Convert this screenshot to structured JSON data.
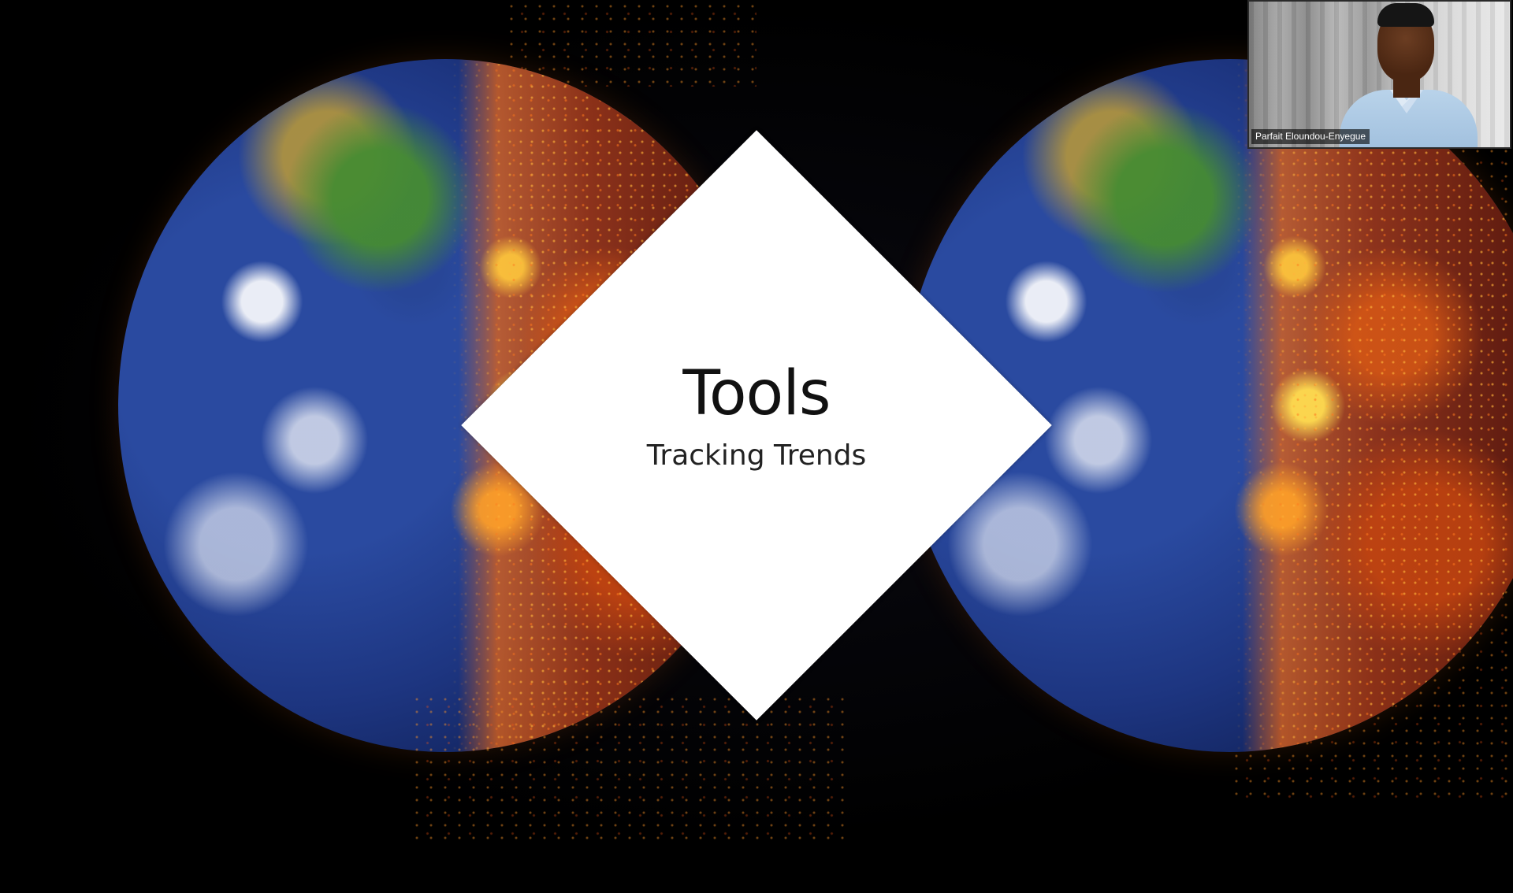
{
  "slide": {
    "title": "Tools",
    "subtitle": "Tracking Trends"
  },
  "video_tile": {
    "participant_name": "Parfait Eloundou-Enyegue"
  },
  "colors": {
    "background": "#000000",
    "diamond_fill": "#ffffff",
    "diamond_outline": "#c8c8d2",
    "title_text": "#111111"
  },
  "icons": [
    "globe-image-left",
    "globe-image-right",
    "participant-video"
  ]
}
